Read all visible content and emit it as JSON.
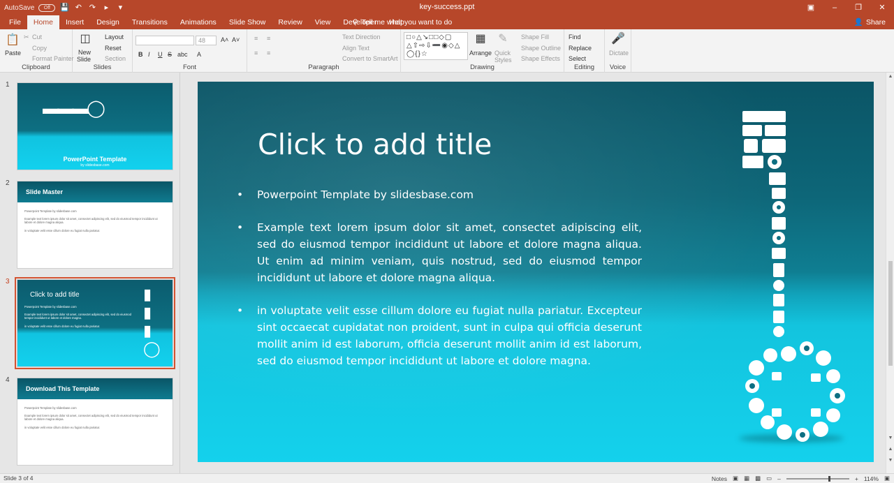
{
  "titlebar": {
    "autosave_label": "AutoSave",
    "autosave_state": "Off",
    "document_title": "key-success.ppt"
  },
  "tabs": [
    "File",
    "Home",
    "Insert",
    "Design",
    "Transitions",
    "Animations",
    "Slide Show",
    "Review",
    "View",
    "Developer",
    "Help"
  ],
  "tell_me": "Tell me what you want to do",
  "share_label": "Share",
  "ribbon": {
    "clipboard": {
      "paste": "Paste",
      "cut": "Cut",
      "copy": "Copy",
      "format_painter": "Format Painter",
      "label": "Clipboard"
    },
    "slides": {
      "new_slide": "New",
      "new_slide_2": "Slide",
      "layout": "Layout",
      "reset": "Reset",
      "section": "Section",
      "label": "Slides"
    },
    "font": {
      "font_size": "48",
      "bold": "B",
      "italic": "I",
      "underline": "U",
      "strike": "S",
      "shadow": "abc",
      "label": "Font"
    },
    "paragraph": {
      "text_direction": "Text Direction",
      "align_text": "Align Text",
      "smartart": "Convert to SmartArt",
      "label": "Paragraph"
    },
    "drawing": {
      "arrange": "Arrange",
      "quick_styles": "Quick",
      "quick_styles_2": "Styles",
      "shape_fill": "Shape Fill",
      "shape_outline": "Shape Outline",
      "shape_effects": "Shape Effects",
      "label": "Drawing"
    },
    "editing": {
      "find": "Find",
      "replace": "Replace",
      "select": "Select",
      "label": "Editing"
    },
    "voice": {
      "dictate": "Dictate",
      "label": "Voice"
    }
  },
  "thumbnails": [
    {
      "num": "1",
      "title": "PowerPoint Template",
      "sub": "by slidesbase.com"
    },
    {
      "num": "2",
      "title": "Slide Master",
      "lines": [
        "Powerpoint Template by slidesbase.com",
        "Example text lorem ipsum dolor sit amet, consectet adipiscing elit, sed do eiusmod tempor incididunt ut labore et dolore magna aliqua.",
        "in voluptate velit esse cillum dolore eu fugiat nulla pariatur."
      ]
    },
    {
      "num": "3",
      "title": "Click to add title",
      "lines": [
        "Powerpoint Template by slidesbase.com",
        "Example text lorem ipsum dolor sit amet, consectet adipiscing elit, sed do eiusmod tempor incididunt ut labore et dolore magna.",
        "in voluptate velit esse cillum dolore eu fugiat nulla pariatur."
      ]
    },
    {
      "num": "4",
      "title": "Download This Template",
      "lines": [
        "Powerpoint Template by slidesbase.com",
        "Example text lorem ipsum dolor sit amet, consectet adipiscing elit, sed do eiusmod tempor incididunt ut labore et dolore magna aliqua.",
        "in voluptate velit esse cillum dolore eu fugiat nulla pariatur."
      ]
    }
  ],
  "slide": {
    "title": "Click to add title",
    "bullets": [
      "Powerpoint Template by slidesbase.com",
      "Example text lorem ipsum dolor sit amet, consectet adipiscing elit, sed do eiusmod tempor incididunt ut labore et dolore magna aliqua. Ut enim ad minim veniam, quis nostrud, sed do eiusmod tempor incididunt ut labore et dolore magna aliqua.",
      "in voluptate velit esse cillum dolore eu fugiat nulla pariatur. Excepteur sint occaecat cupidatat non proident, sunt in culpa qui officia deserunt mollit anim id est laborum, officia deserunt mollit anim id est laborum, sed do eiusmod tempor incididunt ut labore et dolore magna."
    ]
  },
  "status": {
    "slide_position": "Slide 3 of 4",
    "notes": "Notes",
    "zoom": "114%"
  },
  "colors": {
    "accent": "#b7472a",
    "slide_dark": "#0b5566",
    "slide_light": "#14d1ec"
  }
}
